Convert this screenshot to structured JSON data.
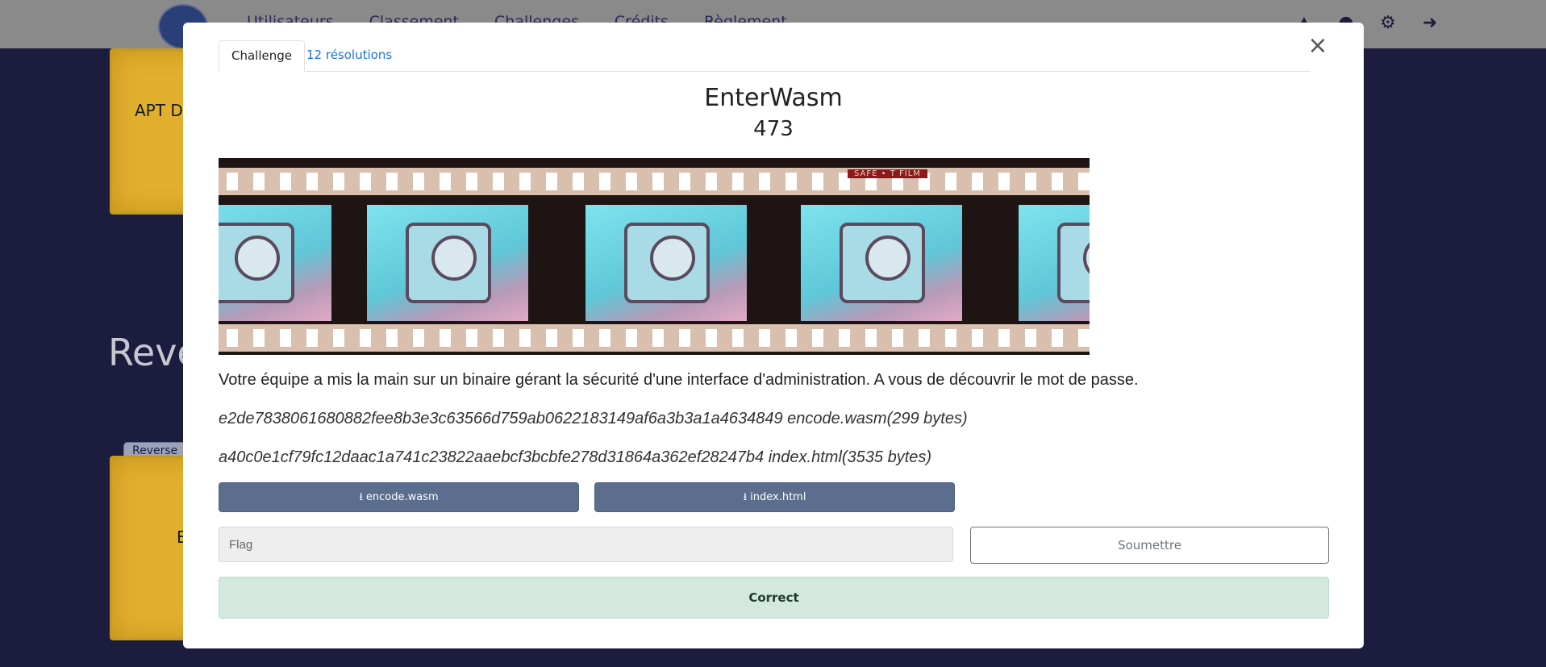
{
  "navbar": {
    "items": [
      "Utilisateurs",
      "Classement",
      "Challenges",
      "Crédits",
      "Règlement"
    ],
    "right_icons": [
      "bell-icon",
      "user-icon",
      "gears-icon",
      "logout-icon"
    ]
  },
  "background": {
    "card_top_label": "APT D",
    "section_title": "Reve",
    "tag": "Reverse",
    "card_bottom_label": "E"
  },
  "modal": {
    "tabs": [
      {
        "label": "Challenge",
        "active": true
      },
      {
        "label": "12 résolutions",
        "active": false
      }
    ],
    "title": "EnterWasm",
    "points": "473",
    "image": {
      "alt": "film-strip-vault-image",
      "film_text": "SAFE • T FILM"
    },
    "description": "Votre équipe a mis la main sur un binaire gérant la sécurité d'une interface d'administration. A vous de découvrir le mot de passe.",
    "files": [
      {
        "hash_line": "e2de7838061680882fee8b3e3c63566d759ab0622183149af6a3b3a1a4634849 encode.wasm(299 bytes)",
        "button_label": "encode.wasm",
        "icon": "download-icon"
      },
      {
        "hash_line": "a40c0e1cf79fc12daac1a741c23822aaebcf3bcbfe278d31864a362ef28247b4 index.html(3535 bytes)",
        "button_label": "index.html",
        "icon": "download-icon"
      }
    ],
    "flag_input": {
      "placeholder": "Flag",
      "value": ""
    },
    "submit_label": "Soumettre",
    "result_text": "Correct",
    "colors": {
      "download_button": "#5b6e8e",
      "result_bg": "#d4e9dd",
      "tab_link": "#1a73e8"
    }
  }
}
